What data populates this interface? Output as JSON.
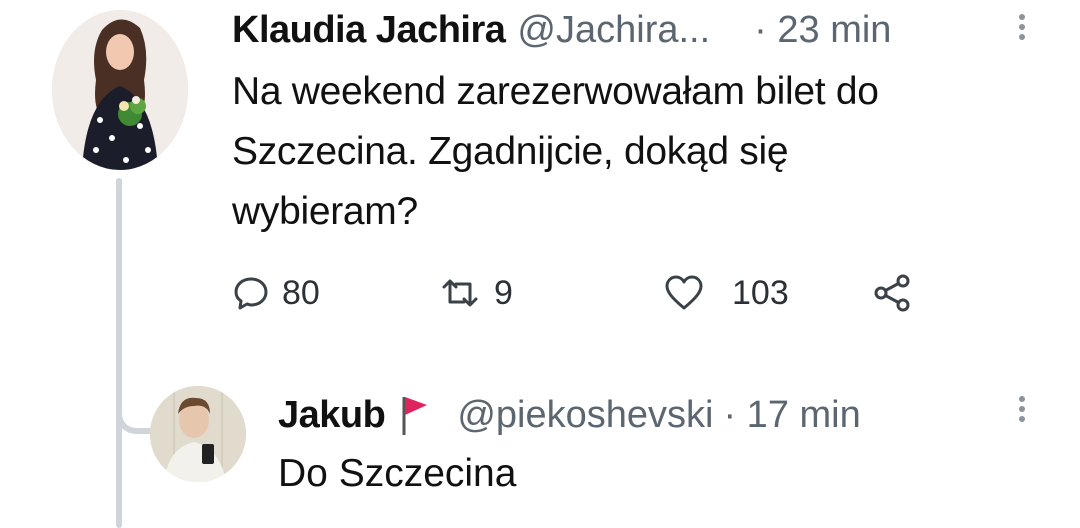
{
  "thread": {
    "tweet": {
      "author_name": "Klaudia Jachira",
      "handle": "@Jachira...",
      "time": "· 23 min",
      "text_lines": [
        "Na weekend zarezerwowałam bilet do",
        "Szczecina. Zgadnijcie, dokąd się",
        "wybieram?"
      ],
      "stats": {
        "replies": "80",
        "retweets": "9",
        "likes": "103"
      },
      "more_icon": "vertical-dots-icon"
    },
    "reply": {
      "author_name": "Jakub",
      "flag_icon": "red-flag-icon",
      "handle": "@piekoshevski",
      "time": "· 17 min",
      "text": "Do Szczecina",
      "more_icon": "vertical-dots-icon"
    }
  },
  "icons": {
    "reply": "speech-bubble-icon",
    "retweet": "retweet-icon",
    "like": "heart-icon",
    "share": "share-icon"
  },
  "colors": {
    "text": "#111111",
    "muted": "#5c6670",
    "thread_line": "#cfd5da",
    "flag": "#e0245e"
  }
}
